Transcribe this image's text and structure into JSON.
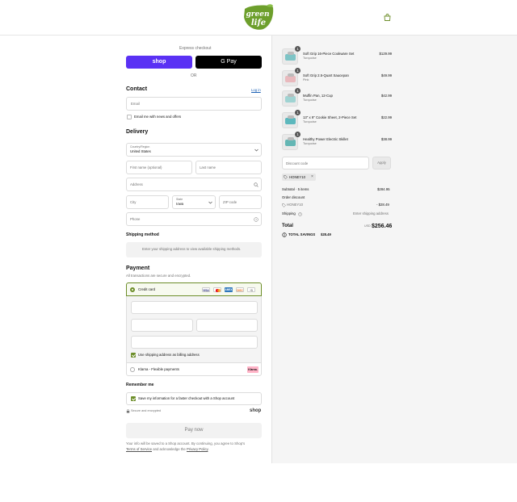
{
  "header": {
    "logo_line1": "green",
    "logo_line2": "life"
  },
  "express": {
    "label": "Express checkout",
    "shop_label": "shop",
    "gpay_label": "G Pay",
    "or_label": "OR"
  },
  "contact": {
    "title": "Contact",
    "login_label": "Log in",
    "email_placeholder": "Email",
    "news_label": "Email me with news and offers"
  },
  "delivery": {
    "title": "Delivery",
    "country_label": "Country/Region",
    "country_value": "United States",
    "first_name_placeholder": "First name (optional)",
    "last_name_placeholder": "Last name",
    "address_placeholder": "Address",
    "city_placeholder": "City",
    "state_label": "State",
    "state_value": "Iowa",
    "zip_placeholder": "ZIP code",
    "phone_placeholder": "Phone"
  },
  "shipping": {
    "title": "Shipping method",
    "message": "Enter your shipping address to view available shipping methods."
  },
  "payment": {
    "title": "Payment",
    "subtitle": "All transactions are secure and encrypted.",
    "credit_label": "Credit card",
    "cards": [
      "VISA",
      "MC",
      "AMEX",
      "DISC",
      "+5"
    ],
    "billing_label": "Use shipping address as billing address",
    "klarna_label": "Klarna - Flexible payments",
    "klarna_badge": "Klarna."
  },
  "remember": {
    "title": "Remember me",
    "save_label": "Save my information for a faster checkout with a Shop account",
    "secure_label": "Secure and encrypted",
    "shop_label": "shop"
  },
  "pay_label": "Pay now",
  "legal": {
    "line1": "Your info will be saved to a Shop account. By continuing, you agree to Shop's",
    "tos": "Terms of Service",
    "mid": " and acknowledge the ",
    "privacy": "Privacy Policy",
    "end": "."
  },
  "cart": {
    "items": [
      {
        "qty": "1",
        "name": "Soft Grip 16-Piece Cookware Set",
        "variant": "Turquoise",
        "price": "$129.99",
        "color": "#7ec4c6"
      },
      {
        "qty": "1",
        "name": "Soft Grip 2.5-Quart Saucepan",
        "variant": "Pink",
        "price": "$49.99",
        "color": "#e9b9bd"
      },
      {
        "qty": "1",
        "name": "Muffin Pan, 12-Cup",
        "variant": "Turquoise",
        "price": "$42.99",
        "color": "#9fd3d2"
      },
      {
        "qty": "1",
        "name": "13\" x 9\" Cookie Sheet, 2-Piece Set",
        "variant": "Turquoise",
        "price": "$22.99",
        "color": "#5db8bd"
      },
      {
        "qty": "1",
        "name": "Healthy Power Electric Skillet",
        "variant": "Turquoise",
        "price": "$38.99",
        "color": "#64b6b4"
      }
    ],
    "discount_placeholder": "Discount code",
    "apply_label": "Apply",
    "code_tag": "HONEY10",
    "subtotal_label": "Subtotal · 5 items",
    "subtotal_value": "$284.95",
    "order_discount_label": "Order discount",
    "discount_code": "HONEY10",
    "discount_value": "- $28.49",
    "shipping_label": "Shipping",
    "shipping_value": "Enter shipping address",
    "total_label": "Total",
    "currency": "USD",
    "total_value": "$256.46",
    "savings_label": "TOTAL SAVINGS",
    "savings_value": "$28.49"
  },
  "colors": {
    "brand_green": "#6d8e2a",
    "shop_purple": "#5a31f4",
    "accent_blue": "#1a5fb4"
  }
}
